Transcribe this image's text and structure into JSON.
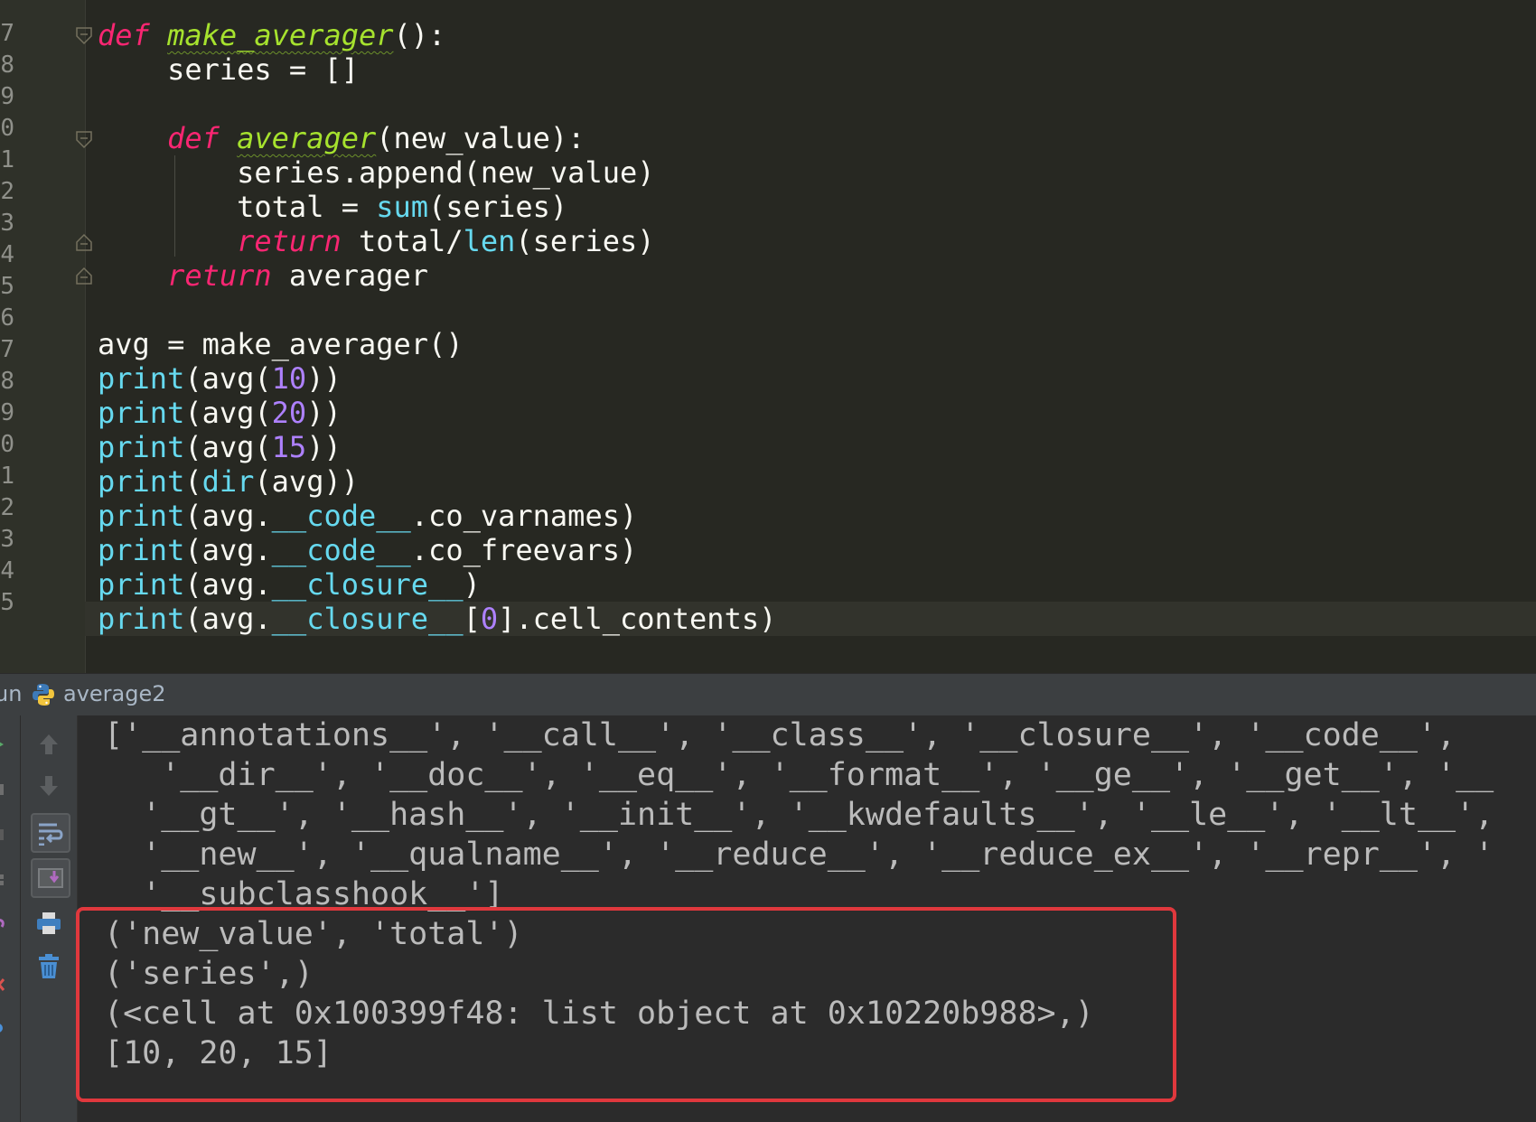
{
  "editor": {
    "line_numbers": [
      "7",
      "8",
      "9",
      "0",
      "1",
      "2",
      "3",
      "4",
      "5",
      "6",
      "7",
      "8",
      "9",
      "0",
      "1",
      "2",
      "3",
      "4",
      "5"
    ],
    "code": {
      "l1_kw": "def",
      "l1_fn": "make_averager",
      "l1_rest": "():",
      "l2": "    series = []",
      "l4_kw": "def",
      "l4_fn": "averager",
      "l4_rest": "(new_value):",
      "l5": "        series.append(new_value)",
      "l6_a": "        total = ",
      "l6_bi": "sum",
      "l6_b": "(series)",
      "l7_kw": "return",
      "l7_a": " total/",
      "l7_bi": "len",
      "l7_b": "(series)",
      "l8_kw": "return",
      "l8_a": " averager",
      "l10": "avg = make_averager()",
      "l11_bi": "print",
      "l11_a": "(avg(",
      "l11_num": "10",
      "l11_b": "))",
      "l12_bi": "print",
      "l12_a": "(avg(",
      "l12_num": "20",
      "l12_b": "))",
      "l13_bi": "print",
      "l13_a": "(avg(",
      "l13_num": "15",
      "l13_b": "))",
      "l14_bi": "print",
      "l14_a": "(",
      "l14_bi2": "dir",
      "l14_b": "(avg))",
      "l15_bi": "print",
      "l15_a": "(avg.",
      "l15_bi2": "__code__",
      "l15_b": ".co_varnames)",
      "l16_bi": "print",
      "l16_a": "(avg.",
      "l16_bi2": "__code__",
      "l16_b": ".co_freevars)",
      "l17_bi": "print",
      "l17_a": "(avg.",
      "l17_bi2": "__closure__",
      "l17_b": ")",
      "l18_bi": "print",
      "l18_a": "(avg.",
      "l18_bi2": "__closure__",
      "l18_b": "[",
      "l18_num": "0",
      "l18_c": "].cell_contents)"
    }
  },
  "run_panel": {
    "label": "un",
    "config_name": "average2"
  },
  "console": {
    "lines": [
      "['__annotations__', '__call__', '__class__', '__closure__', '__code__',",
      "   '__dir__', '__doc__', '__eq__', '__format__', '__ge__', '__get__', '__",
      "  '__gt__', '__hash__', '__init__', '__kwdefaults__', '__le__', '__lt__',",
      "  '__new__', '__qualname__', '__reduce__', '__reduce_ex__', '__repr__', '",
      "  '__subclasshook__']",
      "('new_value', 'total')",
      "('series',)",
      "(<cell at 0x100399f48: list object at 0x10220b988>,)",
      "[10, 20, 15]"
    ]
  },
  "colors": {
    "keyword": "#f92672",
    "function": "#a6e22e",
    "builtin": "#66d9ef",
    "number": "#ae81ff",
    "highlight_border": "#e0383d"
  }
}
